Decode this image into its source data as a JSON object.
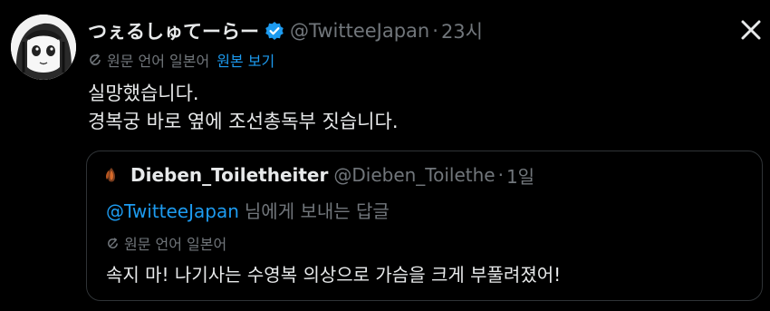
{
  "tweet": {
    "display_name": "つぇるしゅてーらー",
    "handle": "@TwitteeJapan",
    "separator": "·",
    "time": "23시",
    "translate_label": "원문 언어 일본어",
    "show_original": "원본 보기",
    "lines": [
      "실망했습니다.",
      "경복궁 바로 옆에 조선총독부 짓습니다."
    ]
  },
  "quote": {
    "display_name": "Dieben_Toiletheiter",
    "handle": "@Dieben_Toilethe",
    "separator": "·",
    "time": "1일",
    "reply_mention": "@TwitteeJapan",
    "reply_text": "님에게 보내는 답글",
    "translate_label": "원문 언어 일본어",
    "text": "속지 마! 나기사는 수영복 의상으로 가슴을 크게 부풀려졌어!"
  },
  "icons": {
    "verified": "verified-badge-icon",
    "close": "close-icon",
    "translate": "translate-icon"
  },
  "colors": {
    "background": "#000000",
    "text": "#e7e9ea",
    "secondary": "#71767b",
    "accent": "#1d9bf0",
    "border": "#2f3336"
  }
}
